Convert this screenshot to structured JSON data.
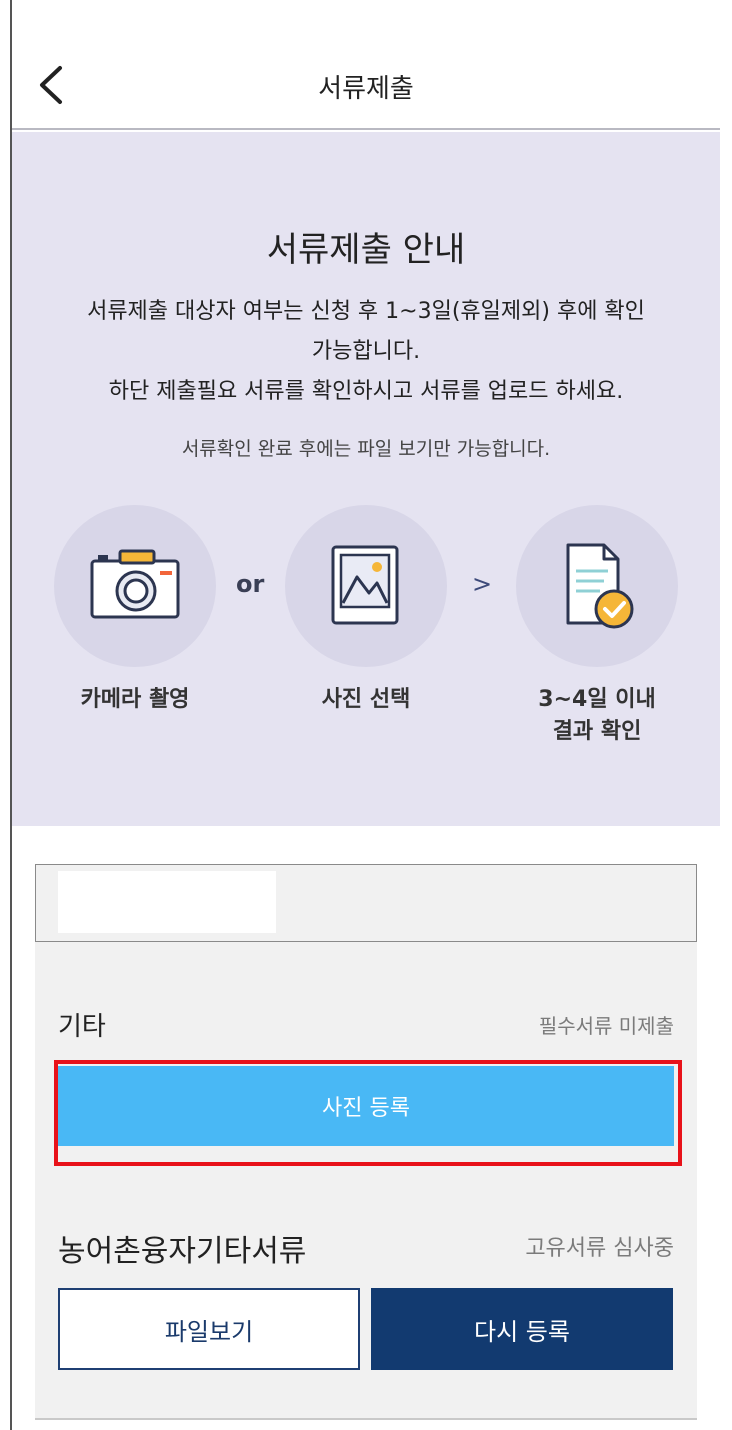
{
  "header": {
    "title": "서류제출",
    "back_icon": "chevron-left-icon"
  },
  "guide": {
    "title": "서류제출 안내",
    "desc_line1": "서류제출 대상자 여부는 신청 후 1~3일(휴일제외) 후에 확인",
    "desc_line2": "가능합니다.",
    "desc_line3": "하단 제출필요 서류를 확인하시고 서류를 업로드 하세요.",
    "note": "서류확인 완료 후에는 파일 보기만 가능합니다.",
    "steps": [
      {
        "label": "카메라 촬영",
        "icon": "camera-icon"
      },
      {
        "label": "사진 선택",
        "icon": "photo-icon"
      },
      {
        "label_line1": "3~4일 이내",
        "label_line2": "결과 확인",
        "icon": "document-check-icon"
      }
    ],
    "separator_or": "or",
    "separator_next": ">"
  },
  "documents": [
    {
      "name": "기타",
      "status": "필수서류 미제출",
      "button": "사진 등록"
    },
    {
      "name": "농어촌융자기타서류",
      "status": "고유서류 심사중",
      "view_button": "파일보기",
      "reupload_button": "다시 등록"
    }
  ],
  "colors": {
    "guide_bg": "#e5e3f1",
    "upload_button": "#49b8f5",
    "reupload_button": "#123a70",
    "highlight": "#e8121a"
  }
}
